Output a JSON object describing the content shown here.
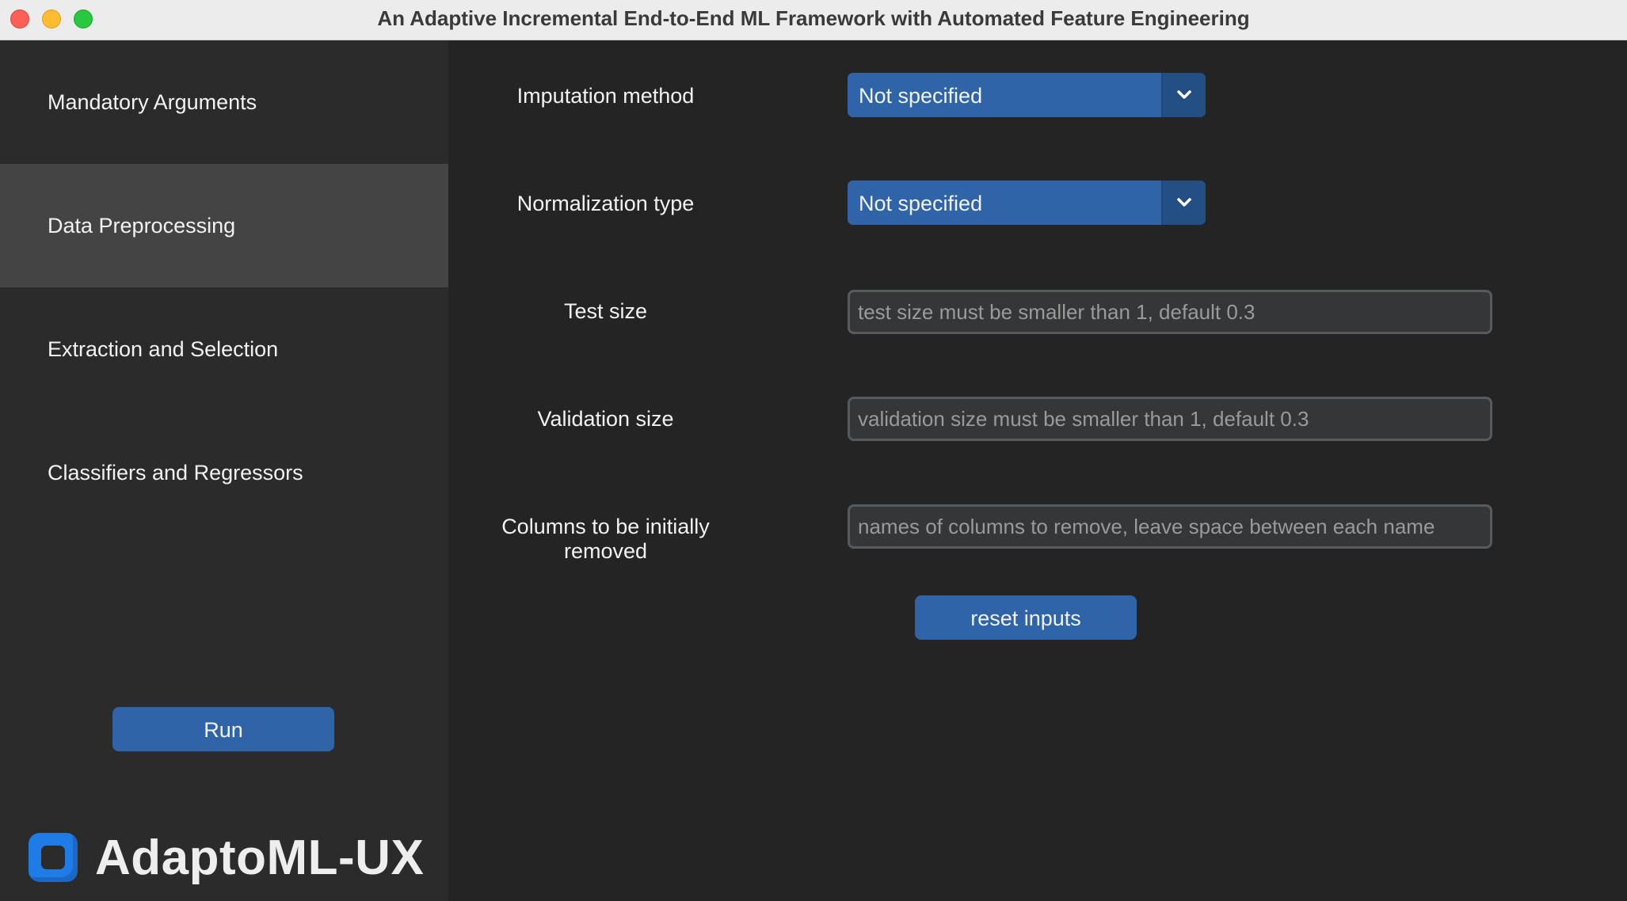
{
  "window": {
    "title": "An Adaptive Incremental End-to-End ML Framework with Automated Feature Engineering"
  },
  "sidebar": {
    "items": [
      {
        "label": "Mandatory Arguments",
        "active": false
      },
      {
        "label": "Data Preprocessing",
        "active": true
      },
      {
        "label": "Extraction and Selection",
        "active": false
      },
      {
        "label": "Classifiers and Regressors",
        "active": false
      }
    ],
    "run_label": "Run",
    "brand": "AdaptoML-UX"
  },
  "form": {
    "imputation": {
      "label": "Imputation method",
      "value": "Not specified"
    },
    "normalization": {
      "label": "Normalization type",
      "value": "Not specified"
    },
    "test_size": {
      "label": "Test size",
      "value": "",
      "placeholder": "test size must be smaller than 1, default 0.3"
    },
    "validation_size": {
      "label": "Validation size",
      "value": "",
      "placeholder": "validation size must be smaller than 1, default 0.3"
    },
    "columns_removed": {
      "label": "Columns to be initially removed",
      "value": "",
      "placeholder": "names of columns to remove, leave space between each name"
    },
    "reset_label": "reset inputs"
  },
  "colors": {
    "accent": "#2f65a8",
    "sidebar_bg": "#2b2b2b",
    "main_bg": "#242424",
    "active_item_bg": "#444444",
    "logo": "#1f7be6"
  },
  "icons": [
    "close-light-icon",
    "minimize-light-icon",
    "maximize-light-icon",
    "chevron-down-icon",
    "app-logo-icon"
  ]
}
